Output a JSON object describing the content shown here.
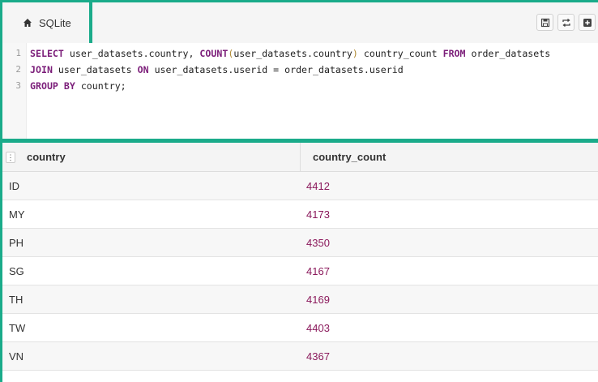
{
  "tab": {
    "label": "SQLite",
    "icon": "home-icon"
  },
  "toolbar": {
    "save_icon": "save-icon",
    "refresh_icon": "refresh-icon",
    "add_icon": "plus-square-icon"
  },
  "editor": {
    "line_numbers": [
      "1",
      "2",
      "3"
    ],
    "lines": [
      [
        {
          "t": "SELECT",
          "c": "kw"
        },
        {
          "t": " user_datasets.country, ",
          "c": ""
        },
        {
          "t": "COUNT",
          "c": "fn"
        },
        {
          "t": "(",
          "c": "paren"
        },
        {
          "t": "user_datasets.country",
          "c": ""
        },
        {
          "t": ")",
          "c": "paren"
        },
        {
          "t": " country_count ",
          "c": ""
        },
        {
          "t": "FROM",
          "c": "kw"
        },
        {
          "t": " order_datasets",
          "c": ""
        }
      ],
      [
        {
          "t": "JOIN",
          "c": "kw"
        },
        {
          "t": " user_datasets ",
          "c": ""
        },
        {
          "t": "ON",
          "c": "kw"
        },
        {
          "t": " user_datasets.userid = order_datasets.userid",
          "c": ""
        }
      ],
      [
        {
          "t": "GROUP BY",
          "c": "kw"
        },
        {
          "t": " country;",
          "c": ""
        }
      ]
    ]
  },
  "results": {
    "columns": [
      "country",
      "country_count"
    ],
    "rows": [
      [
        "ID",
        "4412"
      ],
      [
        "MY",
        "4173"
      ],
      [
        "PH",
        "4350"
      ],
      [
        "SG",
        "4167"
      ],
      [
        "TH",
        "4169"
      ],
      [
        "TW",
        "4403"
      ],
      [
        "VN",
        "4367"
      ]
    ],
    "menu_glyph": "⋮"
  },
  "colors": {
    "accent": "#1aab8a",
    "keyword": "#7b1d79",
    "number": "#8b1a5c"
  }
}
